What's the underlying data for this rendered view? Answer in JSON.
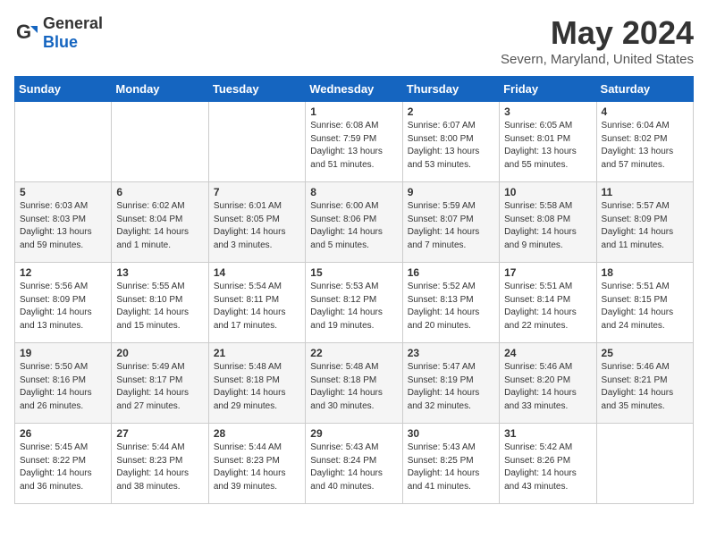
{
  "header": {
    "logo_general": "General",
    "logo_blue": "Blue",
    "month_title": "May 2024",
    "location": "Severn, Maryland, United States"
  },
  "days_of_week": [
    "Sunday",
    "Monday",
    "Tuesday",
    "Wednesday",
    "Thursday",
    "Friday",
    "Saturday"
  ],
  "weeks": [
    [
      {
        "day": "",
        "info": ""
      },
      {
        "day": "",
        "info": ""
      },
      {
        "day": "",
        "info": ""
      },
      {
        "day": "1",
        "info": "Sunrise: 6:08 AM\nSunset: 7:59 PM\nDaylight: 13 hours\nand 51 minutes."
      },
      {
        "day": "2",
        "info": "Sunrise: 6:07 AM\nSunset: 8:00 PM\nDaylight: 13 hours\nand 53 minutes."
      },
      {
        "day": "3",
        "info": "Sunrise: 6:05 AM\nSunset: 8:01 PM\nDaylight: 13 hours\nand 55 minutes."
      },
      {
        "day": "4",
        "info": "Sunrise: 6:04 AM\nSunset: 8:02 PM\nDaylight: 13 hours\nand 57 minutes."
      }
    ],
    [
      {
        "day": "5",
        "info": "Sunrise: 6:03 AM\nSunset: 8:03 PM\nDaylight: 13 hours\nand 59 minutes."
      },
      {
        "day": "6",
        "info": "Sunrise: 6:02 AM\nSunset: 8:04 PM\nDaylight: 14 hours\nand 1 minute."
      },
      {
        "day": "7",
        "info": "Sunrise: 6:01 AM\nSunset: 8:05 PM\nDaylight: 14 hours\nand 3 minutes."
      },
      {
        "day": "8",
        "info": "Sunrise: 6:00 AM\nSunset: 8:06 PM\nDaylight: 14 hours\nand 5 minutes."
      },
      {
        "day": "9",
        "info": "Sunrise: 5:59 AM\nSunset: 8:07 PM\nDaylight: 14 hours\nand 7 minutes."
      },
      {
        "day": "10",
        "info": "Sunrise: 5:58 AM\nSunset: 8:08 PM\nDaylight: 14 hours\nand 9 minutes."
      },
      {
        "day": "11",
        "info": "Sunrise: 5:57 AM\nSunset: 8:09 PM\nDaylight: 14 hours\nand 11 minutes."
      }
    ],
    [
      {
        "day": "12",
        "info": "Sunrise: 5:56 AM\nSunset: 8:09 PM\nDaylight: 14 hours\nand 13 minutes."
      },
      {
        "day": "13",
        "info": "Sunrise: 5:55 AM\nSunset: 8:10 PM\nDaylight: 14 hours\nand 15 minutes."
      },
      {
        "day": "14",
        "info": "Sunrise: 5:54 AM\nSunset: 8:11 PM\nDaylight: 14 hours\nand 17 minutes."
      },
      {
        "day": "15",
        "info": "Sunrise: 5:53 AM\nSunset: 8:12 PM\nDaylight: 14 hours\nand 19 minutes."
      },
      {
        "day": "16",
        "info": "Sunrise: 5:52 AM\nSunset: 8:13 PM\nDaylight: 14 hours\nand 20 minutes."
      },
      {
        "day": "17",
        "info": "Sunrise: 5:51 AM\nSunset: 8:14 PM\nDaylight: 14 hours\nand 22 minutes."
      },
      {
        "day": "18",
        "info": "Sunrise: 5:51 AM\nSunset: 8:15 PM\nDaylight: 14 hours\nand 24 minutes."
      }
    ],
    [
      {
        "day": "19",
        "info": "Sunrise: 5:50 AM\nSunset: 8:16 PM\nDaylight: 14 hours\nand 26 minutes."
      },
      {
        "day": "20",
        "info": "Sunrise: 5:49 AM\nSunset: 8:17 PM\nDaylight: 14 hours\nand 27 minutes."
      },
      {
        "day": "21",
        "info": "Sunrise: 5:48 AM\nSunset: 8:18 PM\nDaylight: 14 hours\nand 29 minutes."
      },
      {
        "day": "22",
        "info": "Sunrise: 5:48 AM\nSunset: 8:18 PM\nDaylight: 14 hours\nand 30 minutes."
      },
      {
        "day": "23",
        "info": "Sunrise: 5:47 AM\nSunset: 8:19 PM\nDaylight: 14 hours\nand 32 minutes."
      },
      {
        "day": "24",
        "info": "Sunrise: 5:46 AM\nSunset: 8:20 PM\nDaylight: 14 hours\nand 33 minutes."
      },
      {
        "day": "25",
        "info": "Sunrise: 5:46 AM\nSunset: 8:21 PM\nDaylight: 14 hours\nand 35 minutes."
      }
    ],
    [
      {
        "day": "26",
        "info": "Sunrise: 5:45 AM\nSunset: 8:22 PM\nDaylight: 14 hours\nand 36 minutes."
      },
      {
        "day": "27",
        "info": "Sunrise: 5:44 AM\nSunset: 8:23 PM\nDaylight: 14 hours\nand 38 minutes."
      },
      {
        "day": "28",
        "info": "Sunrise: 5:44 AM\nSunset: 8:23 PM\nDaylight: 14 hours\nand 39 minutes."
      },
      {
        "day": "29",
        "info": "Sunrise: 5:43 AM\nSunset: 8:24 PM\nDaylight: 14 hours\nand 40 minutes."
      },
      {
        "day": "30",
        "info": "Sunrise: 5:43 AM\nSunset: 8:25 PM\nDaylight: 14 hours\nand 41 minutes."
      },
      {
        "day": "31",
        "info": "Sunrise: 5:42 AM\nSunset: 8:26 PM\nDaylight: 14 hours\nand 43 minutes."
      },
      {
        "day": "",
        "info": ""
      }
    ]
  ]
}
